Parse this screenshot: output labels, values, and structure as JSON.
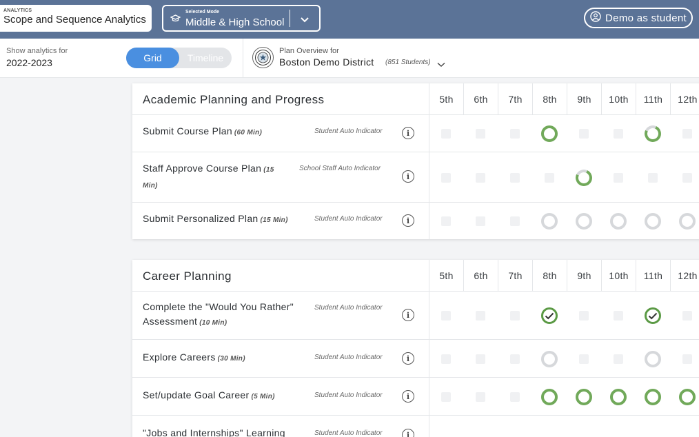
{
  "header": {
    "app_label": "ANALYTICS",
    "app_title": "Scope and Sequence Analytics",
    "mode_label": "Selected Mode",
    "mode_value": "Middle & High School",
    "demo_button": "Demo as student"
  },
  "subheader": {
    "show_label": "Show analytics for",
    "year": "2022-2023",
    "toggle_grid": "Grid",
    "toggle_timeline": "Timeline",
    "plan_label": "Plan Overview for",
    "district": "Boston Demo District",
    "students": "(851 Students)"
  },
  "grades": [
    "5th",
    "6th",
    "7th",
    "8th",
    "9th",
    "10th",
    "11th",
    "12th"
  ],
  "colors": {
    "accent": "#4a8fe0",
    "topbar": "#5b7397",
    "complete": "#71a95a",
    "pending": "#d6d8db"
  },
  "sections": [
    {
      "title": "Academic Planning and Progress",
      "rows": [
        {
          "name": "Submit Course Plan",
          "duration": "(60 Min)",
          "indicator": "Student Auto Indicator",
          "cells": [
            "sq",
            "sq",
            "sq",
            "full",
            "sq",
            "sq",
            "partial",
            "sq"
          ]
        },
        {
          "name": "Staff Approve Course Plan",
          "duration": "(15 Min)",
          "indicator": "School Staff Auto Indicator",
          "cells": [
            "sq",
            "sq",
            "sq",
            "sq",
            "partial",
            "sq",
            "sq",
            "sq"
          ]
        },
        {
          "name": "Submit Personalized Plan",
          "duration": "(15 Min)",
          "indicator": "Student Auto Indicator",
          "cells": [
            "sq",
            "sq",
            "sq",
            "empty",
            "empty",
            "empty",
            "empty",
            "empty"
          ]
        }
      ]
    },
    {
      "title": "Career Planning",
      "rows": [
        {
          "name": "Complete the \"Would You Rather\" Assessment",
          "duration": "(10 Min)",
          "indicator": "Student Auto Indicator",
          "cells": [
            "sq",
            "sq",
            "sq",
            "check",
            "sq",
            "sq",
            "check",
            "sq"
          ]
        },
        {
          "name": "Explore Careers",
          "duration": "(30 Min)",
          "indicator": "Student Auto Indicator",
          "cells": [
            "sq",
            "sq",
            "sq",
            "empty",
            "sq",
            "sq",
            "empty",
            "sq"
          ]
        },
        {
          "name": "Set/update Goal Career",
          "duration": "(5 Min)",
          "indicator": "Student Auto Indicator",
          "cells": [
            "sq",
            "sq",
            "sq",
            "full",
            "full",
            "full",
            "full",
            "full"
          ]
        },
        {
          "name": "\"Jobs and Internships\" Learning",
          "duration": "",
          "indicator": "Student Auto Indicator",
          "cells": [
            "sq",
            "sq",
            "sq",
            "empty",
            "empty",
            "empty",
            "empty",
            "empty"
          ]
        }
      ]
    }
  ]
}
